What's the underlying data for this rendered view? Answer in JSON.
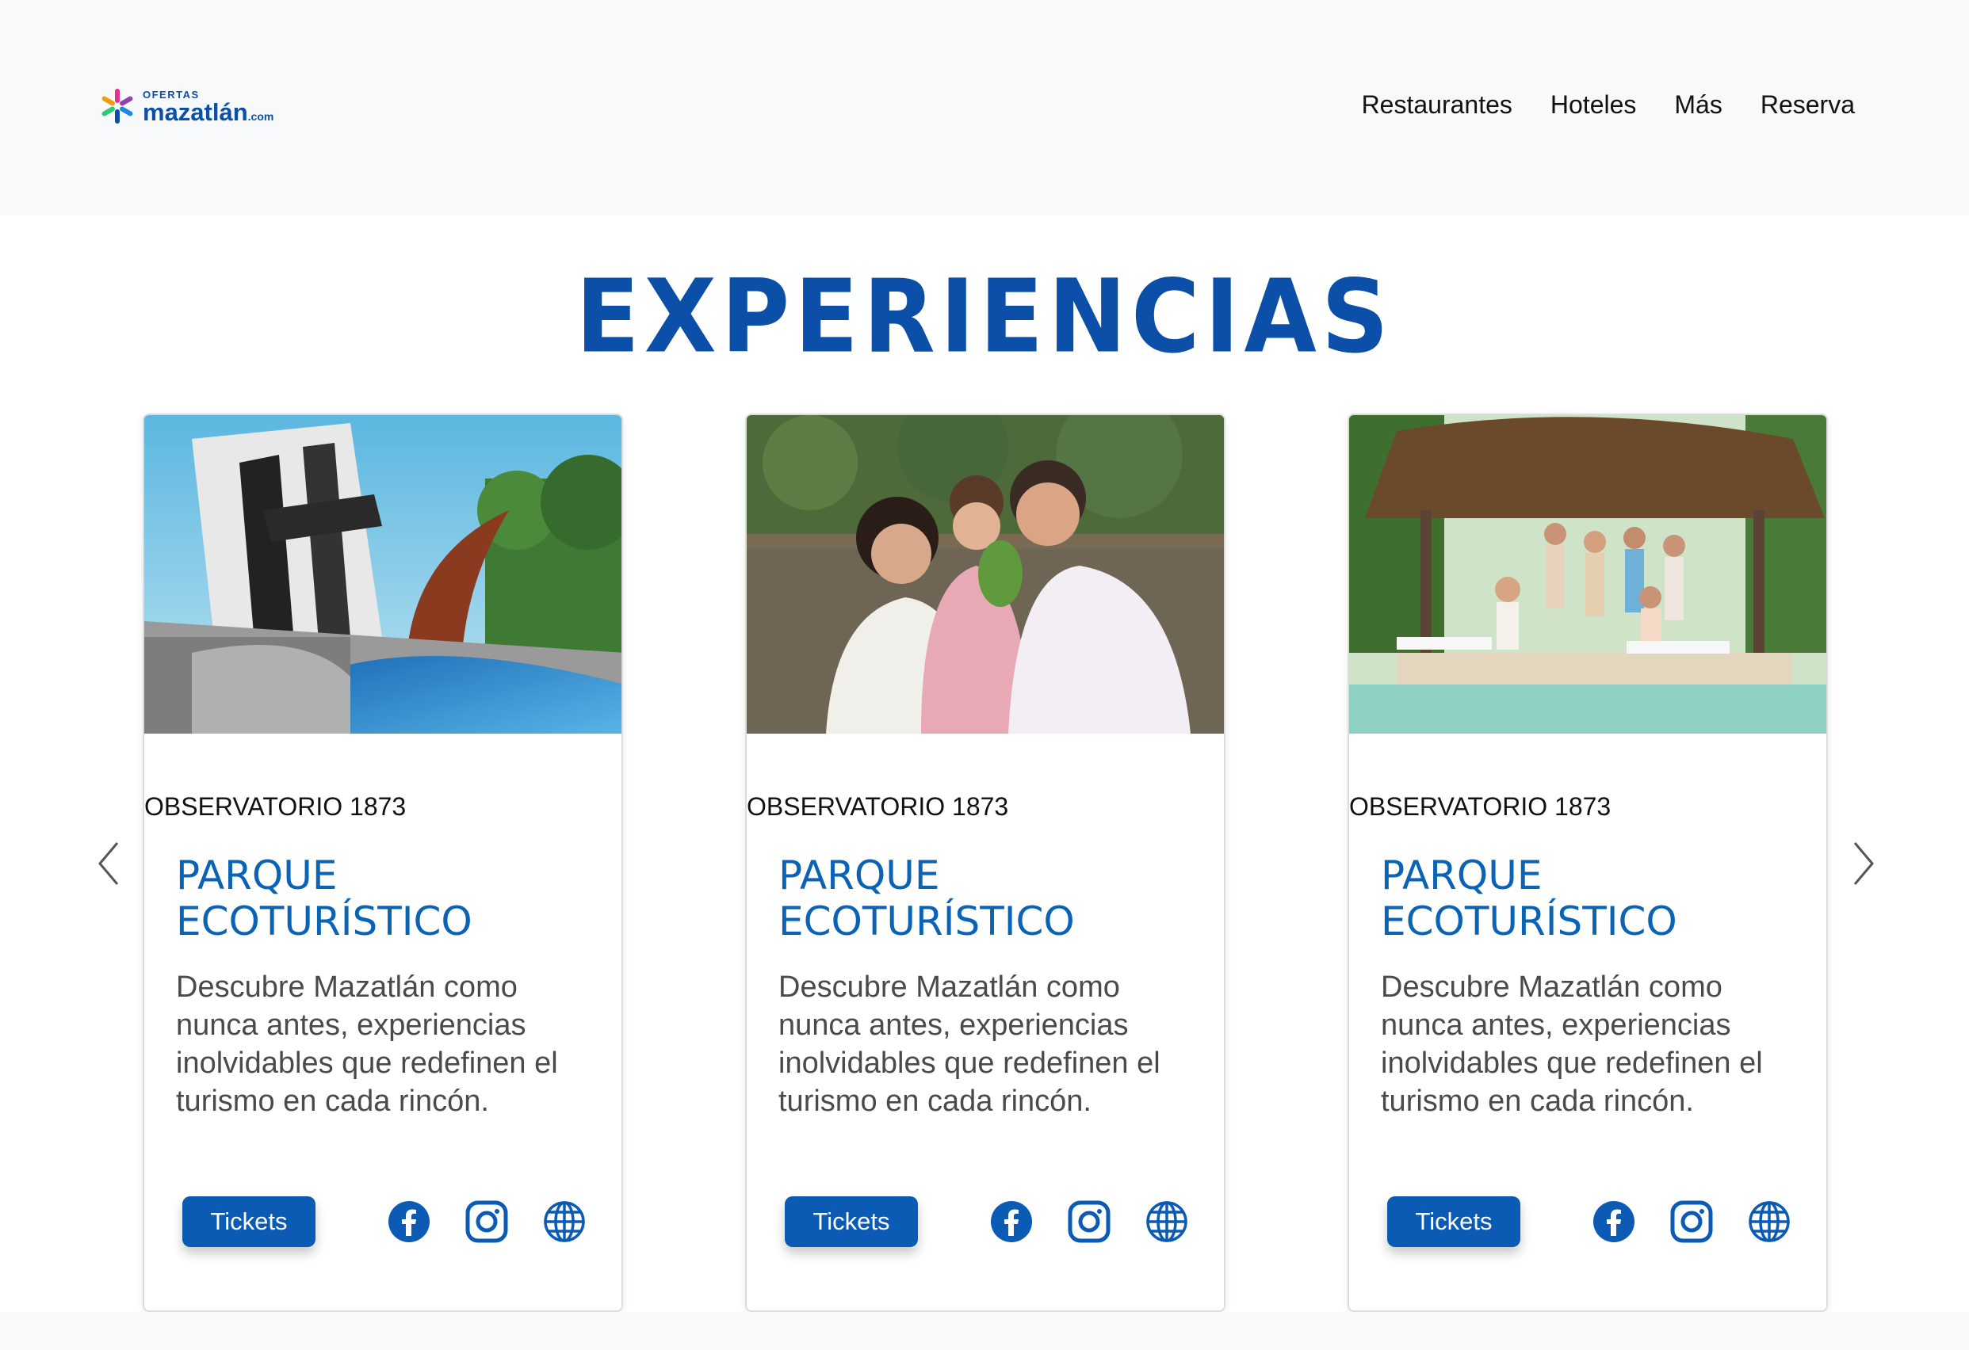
{
  "header": {
    "logo_small": "OFERTAS",
    "logo_big": "mazatlán",
    "logo_suffix": ".com",
    "nav": [
      "Restaurantes",
      "Hoteles",
      "Más",
      "Reserva"
    ]
  },
  "section_title": "EXPERIENCIAS",
  "cards": [
    {
      "kicker": "OBSERVATORIO 1873",
      "title": "PARQUE ECOTURÍSTICO",
      "description": "Descubre Mazatlán como nunca antes, experiencias inolvidables que redefinen el turismo en cada rincón.",
      "button": "Tickets",
      "icons": [
        "facebook-icon",
        "instagram-icon",
        "globe-icon"
      ]
    },
    {
      "kicker": "OBSERVATORIO 1873",
      "title": "PARQUE ECOTURÍSTICO",
      "description": "Descubre Mazatlán como nunca antes, experiencias inolvidables que redefinen el turismo en cada rincón.",
      "button": "Tickets",
      "icons": [
        "facebook-icon",
        "instagram-icon",
        "globe-icon"
      ]
    },
    {
      "kicker": "OBSERVATORIO 1873",
      "title": "PARQUE ECOTURÍSTICO",
      "description": "Descubre Mazatlán como nunca antes, experiencias inolvidables que redefinen el turismo en cada rincón.",
      "button": "Tickets",
      "icons": [
        "facebook-icon",
        "instagram-icon",
        "globe-icon"
      ]
    }
  ],
  "colors": {
    "brand_blue": "#0b4fa8",
    "button_blue": "#0b5bb5",
    "header_bg": "#f8f9fa"
  }
}
